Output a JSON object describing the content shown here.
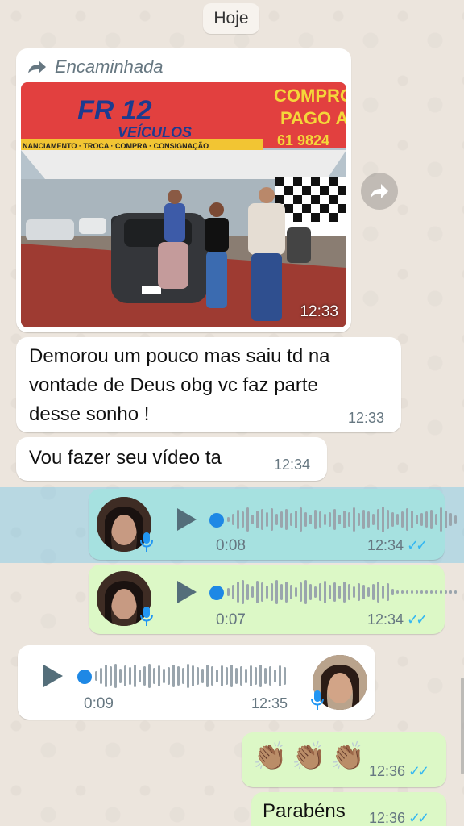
{
  "date_chip": "Hoje",
  "forwarded": {
    "label": "Encaminhada",
    "time": "12:33",
    "photo_sign_line1": "FR 12",
    "photo_sign_line2": "VEÍCULOS",
    "photo_sign_strip": "NANCIAMENTO · TROCA · COMPRA · CONSIGNAÇÃO",
    "photo_sign_right1": "COMPRO",
    "photo_sign_right2": "PAGO A",
    "photo_sign_phone": "61 9824"
  },
  "messages": [
    {
      "text_lines": [
        "Demorou um pouco mas saiu td na",
        "vontade de Deus  obg vc faz parte",
        "desse sonho !"
      ],
      "time": "12:33"
    },
    {
      "text": "Vou fazer seu vídeo ta",
      "time": "12:34"
    }
  ],
  "voice_out": [
    {
      "duration": "0:08",
      "time": "12:34",
      "ticks": "✓✓"
    },
    {
      "duration": "0:07",
      "time": "12:34",
      "ticks": "✓✓"
    }
  ],
  "voice_in": {
    "duration": "0:09",
    "time": "12:35"
  },
  "claps": {
    "emoji": "👏🏽👏🏽👏🏽",
    "time": "12:36",
    "ticks": "✓✓"
  },
  "last": {
    "text": "Parabéns",
    "time": "12:36",
    "ticks": "✓✓"
  },
  "colors": {
    "incoming": "#ffffff",
    "outgoing": "#dcf8c6",
    "selected": "#a6d8ee",
    "tick_blue": "#34b7f1"
  }
}
